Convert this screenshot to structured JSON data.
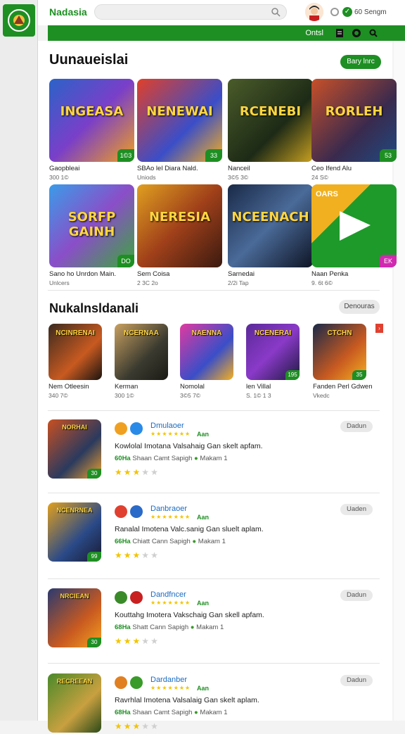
{
  "app": {
    "brand": "Nadasia",
    "status_text": "60 Sengm"
  },
  "greenbar": {
    "label": "Ontsl"
  },
  "colors": {
    "accent": "#1e8f23",
    "link": "#1a6bc2",
    "star": "#f2c400"
  },
  "section1": {
    "title": "Uunaueislai",
    "button": "Bary lnrc",
    "cards": [
      {
        "art_title": "INGEASA",
        "badge": "1©3",
        "name": "Gaopbleai",
        "sub": "300 1©",
        "bg": "linear-gradient(135deg,#2a63c8,#7a3fc8 50%,#f0a020)"
      },
      {
        "art_title": "NENEWAI",
        "badge": "33",
        "name": "SBAo lel Diara Nald.",
        "sub": "Uniods",
        "bg": "linear-gradient(135deg,#e04028,#3a4ec8 60%,#f5b020)"
      },
      {
        "art_title": "RCENEBI",
        "badge": "",
        "name": "Nanceil",
        "sub": "3©5 3©",
        "bg": "linear-gradient(135deg,#4b5c2a,#1d2a16 60%,#c8a020)"
      },
      {
        "art_title": "RORLEH",
        "badge": "53",
        "name": "Ceo Ifend Alu",
        "sub": "24 S©",
        "bg": "linear-gradient(135deg,#c85028,#3a2a4e 60%,#1e4a80)"
      },
      {
        "art_title": "SORFP GAINH",
        "badge": "DO",
        "name": "Sano ho Unrdon Main.",
        "sub": "Unlcers",
        "bg": "linear-gradient(135deg,#3a9ce8,#8a4ec8 50%,#3aa83a)"
      },
      {
        "art_title": "NERESIA",
        "badge": "",
        "name": "Sem Coisa",
        "sub": "2 3C 2o",
        "bg": "linear-gradient(135deg,#e0a020,#a0401a 50%,#3a1a10)"
      },
      {
        "art_title": "NCEENACH",
        "badge": "",
        "name": "Sarnedai",
        "sub": "2/2i Tap",
        "bg": "linear-gradient(135deg,#1a2a48,#4a6a98 50%,#0e1424)"
      },
      {
        "art_title": "OARS",
        "badge": "EK",
        "name": "Naan Penka",
        "sub": "9. 6t 6©",
        "bg": "special"
      }
    ]
  },
  "section2": {
    "title": "Nukalnsldanali",
    "button": "Denouras",
    "cards": [
      {
        "art_title": "NCINRENAI",
        "badge": "",
        "name": "Nem Otleesin",
        "sub": "340 7©",
        "bg": "linear-gradient(135deg,#3a2a20,#c85a20 60%,#1a1410)"
      },
      {
        "art_title": "NCERNAA",
        "badge": "",
        "name": "Kerman",
        "sub": "300 1©",
        "bg": "linear-gradient(135deg,#c8a060,#3a3a30 60%,#1a1a14)"
      },
      {
        "art_title": "NAENNA",
        "badge": "",
        "name": "Nomolal",
        "sub": "3©5 7©",
        "bg": "linear-gradient(135deg,#e03aa0,#3a4ec8 60%,#f5b020)"
      },
      {
        "art_title": "NCENERAI",
        "badge": "195",
        "name": "len Villal",
        "sub": "S. 1© 1 3",
        "bg": "linear-gradient(135deg,#5a2a98,#8a3ac8 50%,#1e1a40)"
      },
      {
        "art_title": "CTCHN",
        "badge": "35",
        "name": "Fanden Perl Gdwen",
        "sub": "Vkedc",
        "bg": "linear-gradient(135deg,#1a2a48,#c85a20 60%,#f5b020)"
      }
    ]
  },
  "list": [
    {
      "art_title": "NORHAI",
      "badge": "30",
      "name": "Dmulaoer",
      "tag": "Aan",
      "desc": "Kowlolal Imotana Valsahaig Gan skelt apfam.",
      "meta_green": "60Ha",
      "meta": "Shaan Camt Sapigh",
      "meta2": "Makam 1",
      "button": "Dadun",
      "bg": "linear-gradient(135deg,#c85020,#2a3a5e 60%,#f0a030)",
      "stars": 3
    },
    {
      "art_title": "NCENRNEA",
      "badge": "99",
      "name": "Danbraoer",
      "tag": "Aan",
      "desc": "Ranalal Imotena Valc.sanig Gan sluelt aplam.",
      "meta_green": "66Ha",
      "meta": "Chiatt Cann Sapigh",
      "meta2": "Makam 1",
      "button": "Uaden",
      "bg": "linear-gradient(135deg,#e0a020,#2a4a88 60%,#1a1a30)",
      "stars": 3
    },
    {
      "art_title": "NRCIEAN",
      "badge": "30",
      "name": "Dandfncer",
      "tag": "Aan",
      "desc": "Kouttahg Imotera Vakschaig Gan skell apfam.",
      "meta_green": "68Ha",
      "meta": "Shatt Cann Sapigh",
      "meta2": "Makam 1",
      "button": "Dadun",
      "bg": "linear-gradient(135deg,#2a3a6e,#c85a20 60%,#f5a020)",
      "stars": 3
    },
    {
      "art_title": "RECREEAN",
      "badge": "",
      "name": "Dardanber",
      "tag": "Aan",
      "desc": "Ravrhlal Imotena Valsalaig Gan skelt aplam.",
      "meta_green": "68Ha",
      "meta": "Shaan Camt Sapigh",
      "meta2": "Makam 1",
      "button": "Dadun",
      "bg": "linear-gradient(135deg,#4a8a2a,#c8a040 60%,#2a4a18)",
      "stars": 3
    }
  ]
}
